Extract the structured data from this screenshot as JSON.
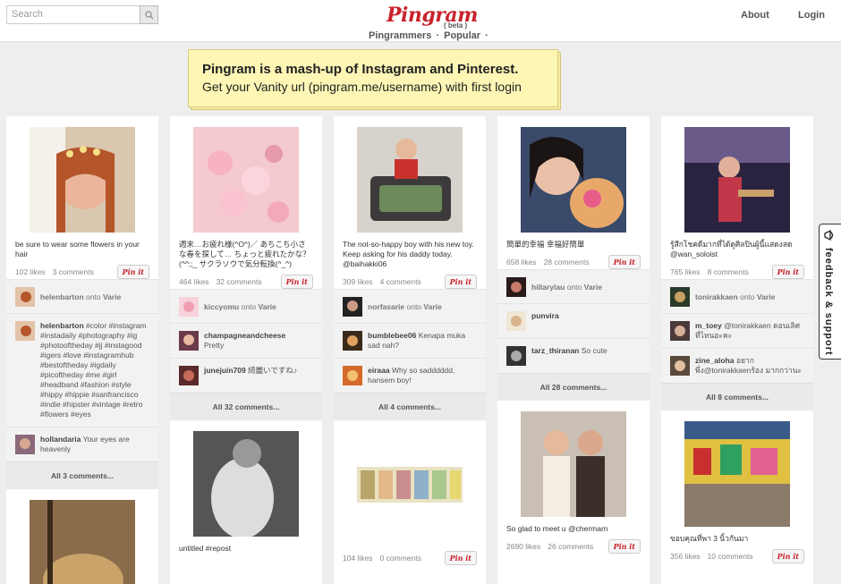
{
  "header": {
    "search_placeholder": "Search",
    "logo_text": "Pingram",
    "beta": "( beta )",
    "subnav": [
      "Pingrammers",
      "·",
      "Popular",
      "·"
    ],
    "about": "About",
    "login": "Login"
  },
  "banner": {
    "line1": "Pingram is a mash-up of Instagram and Pinterest.",
    "line2": "Get your Vanity url (pingram.me/username) with first login"
  },
  "feedback": "feedback & support",
  "pinit_label": "Pin it",
  "columns": [
    {
      "desc": "be sure to wear some flowers in your hair",
      "likes": "102 likes",
      "comments": "3 comments",
      "via_user": "helenbarton",
      "via_onto": "onto",
      "via_board": "Varie",
      "c1_user": "helenbarton",
      "c1_text": "#color #instagram #instadaily #photography #ig #photooftheday #jj #instagood #igers #love #instagramhub #bestoftheday #igdaily #picoftheday #me #girl #headband #fashion #style #hippy #hippie #sanfrancisco #indie #hipster #vintage #retro #flowers #eyes",
      "c2_user": "hollandaria",
      "c2_text": "Your eyes are heavenly",
      "all": "All 3 comments..."
    },
    {
      "desc": "週末…お疲れ様(^O^)／ あちこち小さな春を探して… ちょっと疲れたかな？(^^;;_ サクラソウで気分転換(^_^)",
      "likes": "464 likes",
      "comments": "32 comments",
      "via_user": "kiccyomu",
      "via_onto": "onto",
      "via_board": "Varie",
      "c1_user": "champagneandcheese",
      "c1_text": "Pretty",
      "c2_user": "junejuin709",
      "c2_text": "綺麗いですね♪",
      "all": "All 32 comments...",
      "desc2": "untitled #repost"
    },
    {
      "desc": "The not-so-happy boy with his new toy. Keep asking for his daddy today. @baihakki06",
      "likes": "309 likes",
      "comments": "4 comments",
      "via_user": "norfasarie",
      "via_onto": "onto",
      "via_board": "Varie",
      "c1_user": "bumblebee06",
      "c1_text": "Kenapa muka sad nah?",
      "c2_user": "eiraaa",
      "c2_text": "Why so sadddddd, hansem boy!",
      "all": "All 4 comments...",
      "likes2": "104 likes",
      "comments2": "0 comments"
    },
    {
      "desc": "簡單的幸福 幸福好簡單",
      "likes": "658 likes",
      "comments": "28 comments",
      "via_user": "hillarylau",
      "via_onto": "onto",
      "via_board": "Varie",
      "c1_user": "punvira",
      "c1_text": "",
      "c2_user": "tarz_thiranan",
      "c2_text": "So cute",
      "all": "All 28 comments...",
      "desc2": "So glad to meet u @chermarn",
      "likes2": "2690 likes",
      "comments2": "26 comments"
    },
    {
      "desc": "รู้สึกโชคดีมากที่ได้ดูศิลปินผู้นี้แสดงสด @wan_soloist",
      "likes": "765 likes",
      "comments": "8 comments",
      "via_user": "tonirakkaen",
      "via_onto": "onto",
      "via_board": "Varie",
      "c1_user": "m_toey",
      "c1_text": "@tonirakkaen ดอนเลิศที่ไหนอะคะ",
      "c2_user": "zine_aloha",
      "c2_text": "อยาก พี่ง@tonirakkaenร้อง มากกว่านะ",
      "all": "All 8 comments...",
      "desc2": "ขอบคุณที่พา 3 นิ้วกันมา",
      "likes2": "356 likes",
      "comments2": "10 comments"
    }
  ]
}
